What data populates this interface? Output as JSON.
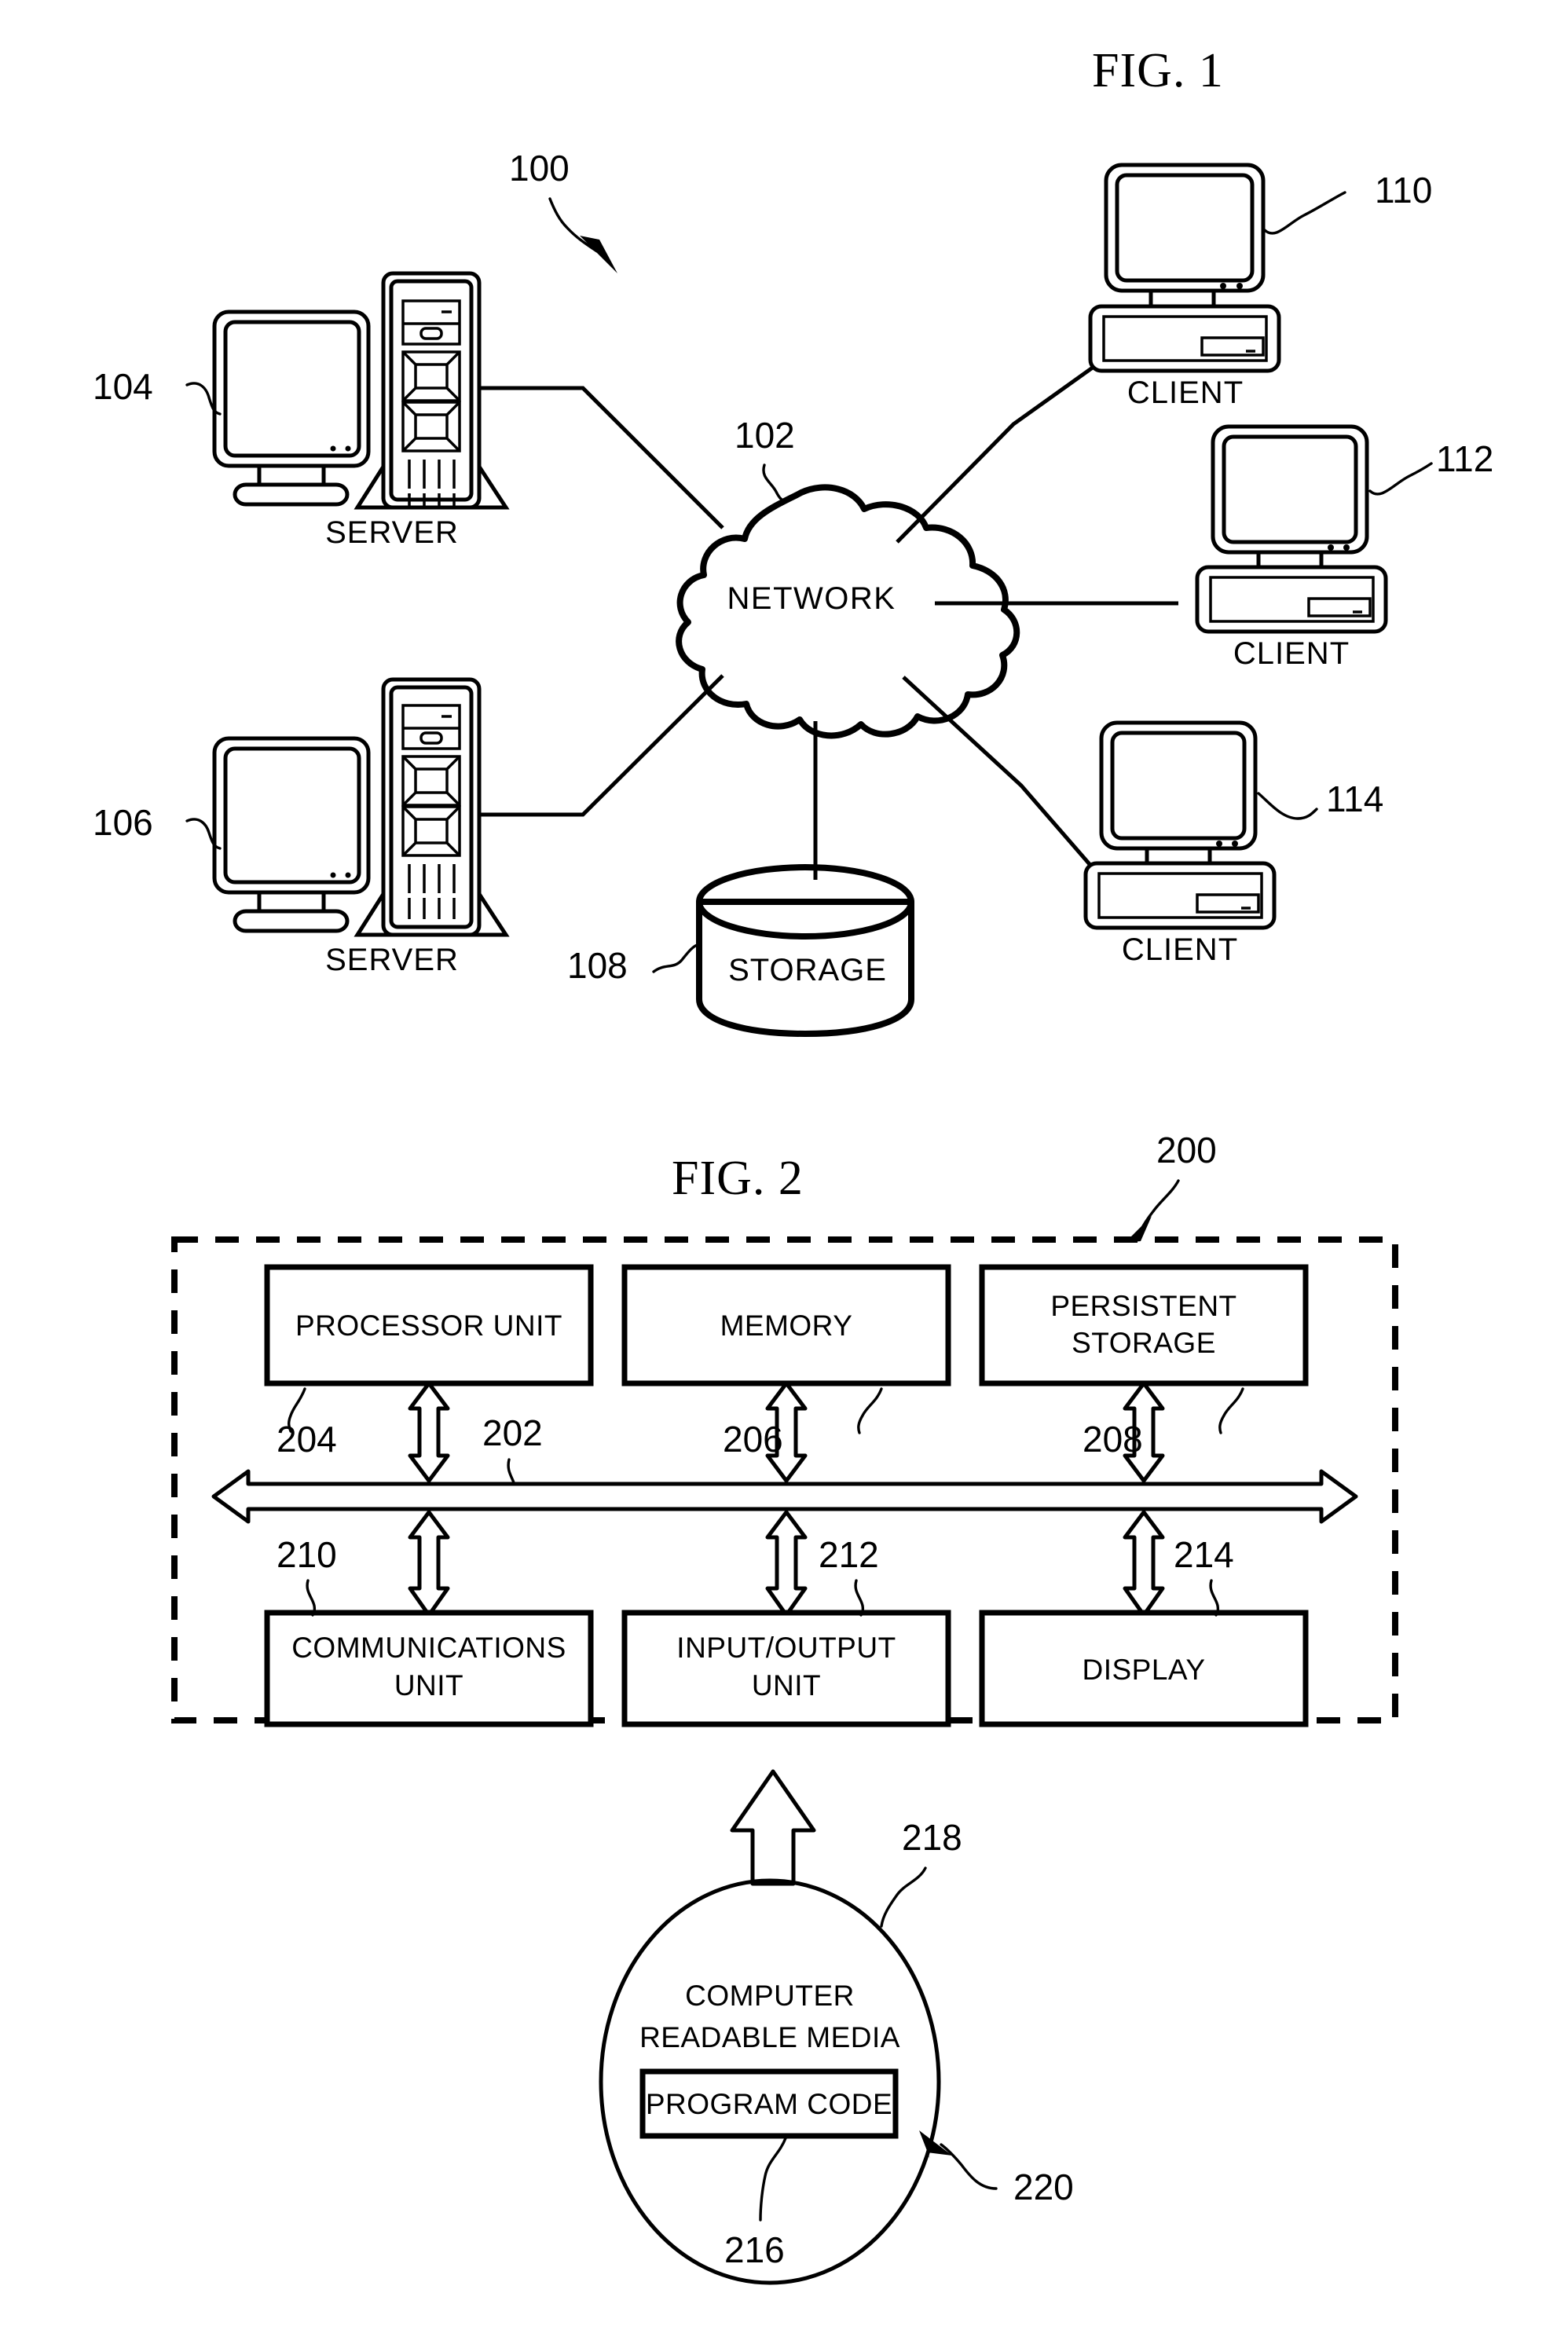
{
  "sheet": {
    "background": "#ffffff",
    "ink": "#000000"
  },
  "figure1": {
    "title": "FIG. 1",
    "system_ref": "100",
    "network": {
      "label": "NETWORK",
      "ref": "102"
    },
    "storage": {
      "label": "STORAGE",
      "ref": "108"
    },
    "servers": [
      {
        "label": "SERVER",
        "ref": "104"
      },
      {
        "label": "SERVER",
        "ref": "106"
      }
    ],
    "clients": [
      {
        "label": "CLIENT",
        "ref": "110"
      },
      {
        "label": "CLIENT",
        "ref": "112"
      },
      {
        "label": "CLIENT",
        "ref": "114"
      }
    ]
  },
  "figure2": {
    "title": "FIG. 2",
    "system_ref": "200",
    "bus_ref": "202",
    "top_row": [
      {
        "label": "PROCESSOR UNIT",
        "lines": [
          "PROCESSOR UNIT"
        ],
        "ref": "204"
      },
      {
        "label": "MEMORY",
        "lines": [
          "MEMORY"
        ],
        "ref": "206"
      },
      {
        "label": "PERSISTENT STORAGE",
        "lines": [
          "PERSISTENT",
          "STORAGE"
        ],
        "ref": "208"
      }
    ],
    "bottom_row": [
      {
        "label": "COMMUNICATIONS UNIT",
        "lines": [
          "COMMUNICATIONS",
          "UNIT"
        ],
        "ref": "210"
      },
      {
        "label": "INPUT/OUTPUT UNIT",
        "lines": [
          "INPUT/OUTPUT",
          "UNIT"
        ],
        "ref": "212"
      },
      {
        "label": "DISPLAY",
        "lines": [
          "DISPLAY"
        ],
        "ref": "214"
      }
    ],
    "media": {
      "lines": [
        "COMPUTER",
        "READABLE MEDIA"
      ],
      "ref": "218",
      "outer_ref": "220",
      "program_code": {
        "label": "PROGRAM CODE",
        "ref": "216"
      }
    }
  }
}
